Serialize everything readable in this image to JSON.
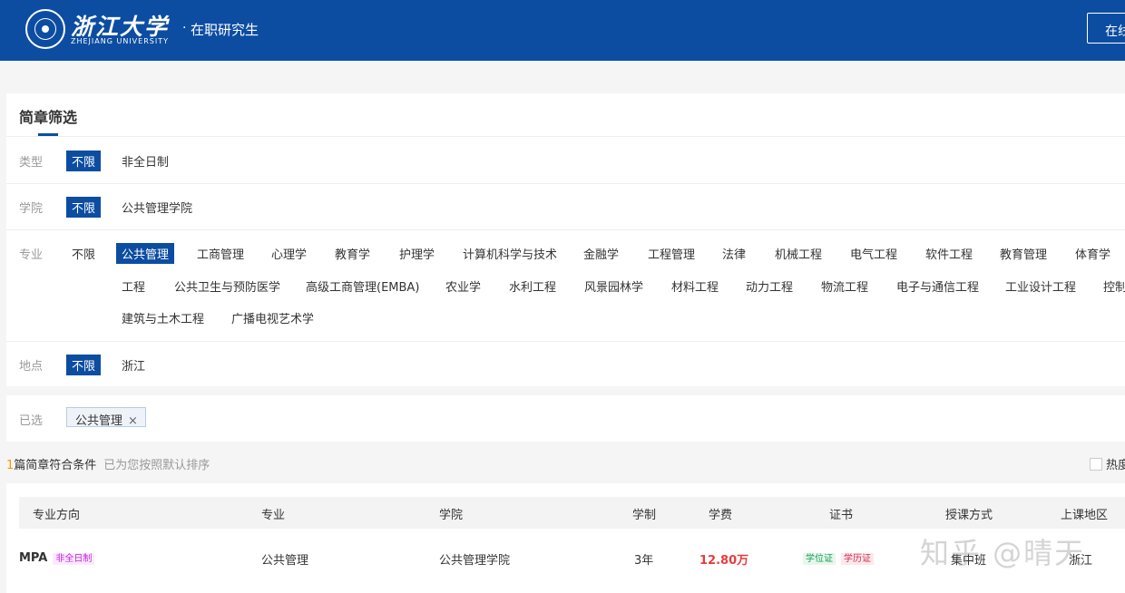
{
  "header": {
    "logo_cn": "浙江大学",
    "logo_en": "ZHEJIANG UNIVERSITY",
    "dot": "·",
    "title": "在职研究生",
    "right_button": "在线"
  },
  "filter": {
    "title": "简章筛选",
    "type": {
      "label": "类型",
      "options": [
        "不限",
        "非全日制"
      ]
    },
    "college": {
      "label": "学院",
      "options": [
        "不限",
        "公共管理学院"
      ]
    },
    "major": {
      "label": "专业",
      "options": [
        "不限",
        "公共管理",
        "工商管理",
        "心理学",
        "教育学",
        "护理学",
        "计算机科学与技术",
        "金融学",
        "工程管理",
        "法律",
        "机械工程",
        "电气工程",
        "软件工程",
        "教育管理",
        "体育学",
        "工程",
        "公共卫生与预防医学",
        "高级工商管理(EMBA)",
        "农业学",
        "水利工程",
        "风景园林学",
        "材料工程",
        "动力工程",
        "物流工程",
        "电子与通信工程",
        "工业设计工程",
        "控制",
        "建筑与土木工程",
        "广播电视艺术学"
      ]
    },
    "location": {
      "label": "地点",
      "options": [
        "不限",
        "浙江"
      ]
    },
    "selected": {
      "label": "已选",
      "tags": [
        "公共管理"
      ],
      "remove_icon": "×"
    }
  },
  "results": {
    "count": "1",
    "text": "篇简章符合条件",
    "hint": "已为您按照默认排序",
    "hot_label": "热度"
  },
  "table": {
    "headers": [
      "专业方向",
      "专业",
      "学院",
      "学制",
      "学费",
      "证书",
      "授课方式",
      "上课地区"
    ],
    "row": {
      "direction": "MPA",
      "direction_badge": "非全日制",
      "major": "公共管理",
      "college": "公共管理学院",
      "duration": "3年",
      "fee": "12.80万",
      "cert1": "学位证",
      "cert2": "学历证",
      "mode": "集中班",
      "region": "浙江"
    }
  },
  "watermark": "知乎 @晴天",
  "colors": {
    "brand": "#0c4da2",
    "accent_orange": "#f39800",
    "fee_red": "#e83c3c"
  }
}
